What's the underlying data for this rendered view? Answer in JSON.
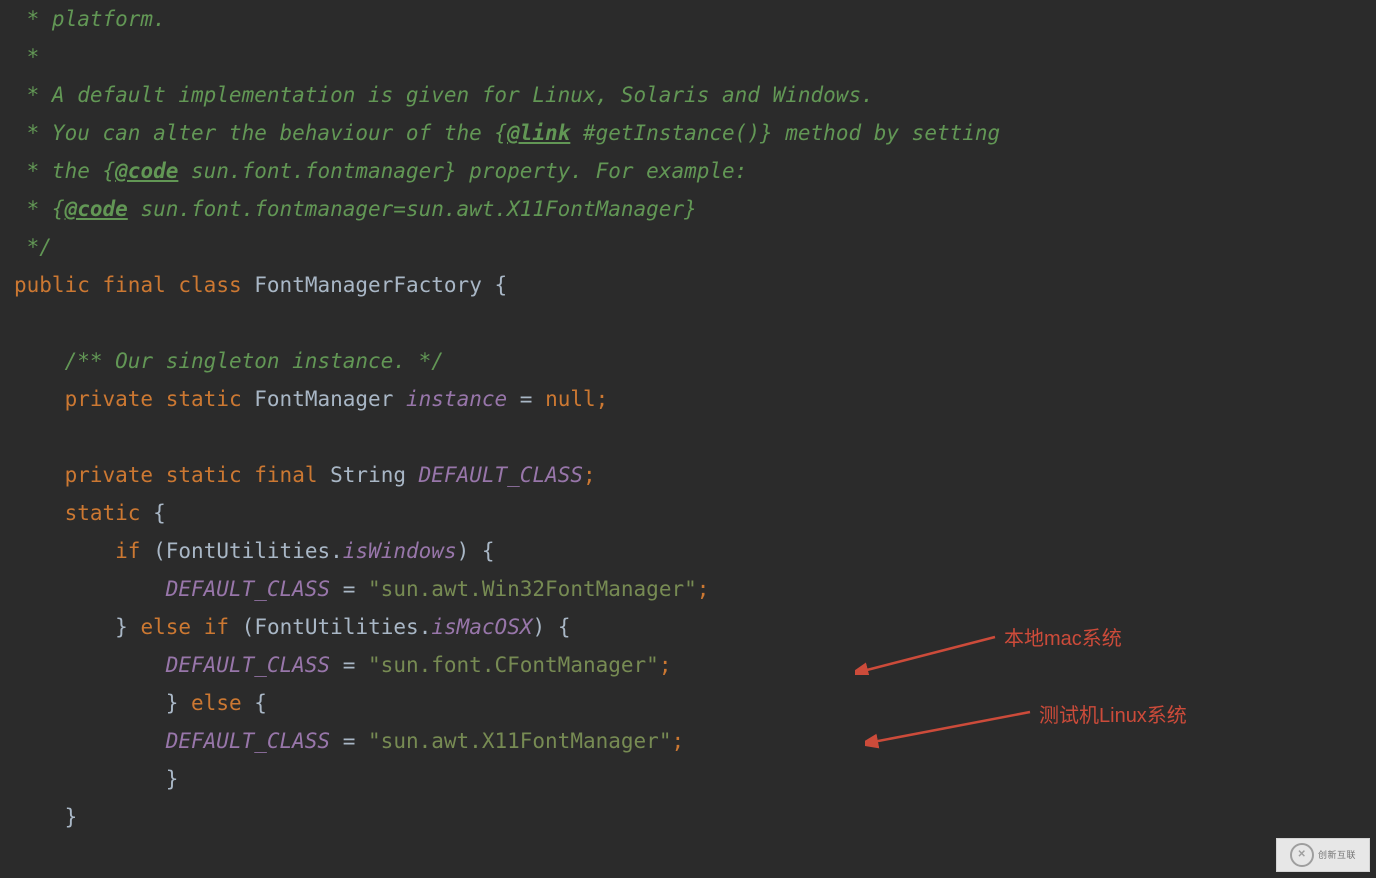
{
  "code": {
    "c2": " * platform.",
    "c3": " *",
    "c4": " * A default implementation is given for Linux, Solaris and Windows.",
    "c5a": " * You can alter the behaviour of the {",
    "c5_link": "@link",
    "c5b": " #getInstance()} method by setting",
    "c6a": " * the {",
    "c6_code": "@code",
    "c6b": " sun.font.fontmanager} property. For example:",
    "c7a": " * {",
    "c7_code": "@code",
    "c7b": " sun.font.fontmanager=sun.awt.X11FontManager}",
    "c8": " */",
    "kw_public": "public",
    "kw_final": "final",
    "kw_class": "class",
    "cls_factory": "FontManagerFactory",
    "brace_open": " {",
    "c_singleton": "/** Our singleton instance. */",
    "kw_private": "private",
    "kw_static": "static",
    "type_fm": "FontManager",
    "fld_instance": "instance",
    "eq": " = ",
    "kw_null": "null",
    "semi": ";",
    "kw_final2": "final",
    "type_string": "String",
    "fld_default": "DEFAULT_CLASS",
    "kw_static2": "static",
    "kw_if": "if",
    "cls_futil": "FontUtilities",
    "fld_iswin": "isWindows",
    "str_win": "\"sun.awt.Win32FontManager\"",
    "kw_else": "else",
    "fld_ismac": "isMacOSX",
    "str_mac": "\"sun.font.CFontManager\"",
    "str_x11": "\"sun.awt.X11FontManager\"",
    "dot": ".",
    "lparen": "(",
    "rparen": ")",
    "brace_l": "{",
    "brace_r": "}",
    "sp1": " ",
    "sp4": "    ",
    "sp8": "        "
  },
  "annotations": {
    "mac": "本地mac系统",
    "linux": "测试机Linux系统"
  },
  "watermark": {
    "text": "创新互联"
  }
}
